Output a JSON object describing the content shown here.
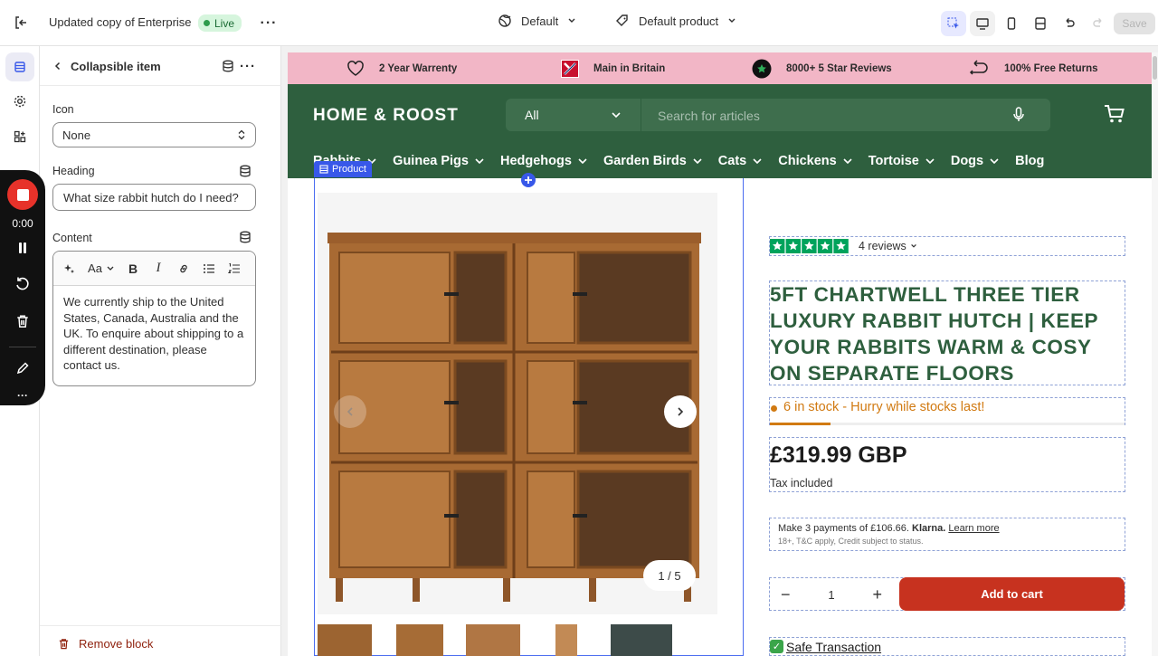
{
  "topbar": {
    "title": "Updated copy of Enterprise",
    "status": "Live",
    "theme_label": "Default",
    "template_label": "Default product",
    "save_label": "Save"
  },
  "recorder": {
    "time": "0:00"
  },
  "panel": {
    "title": "Collapsible item",
    "icon_label": "Icon",
    "icon_value": "None",
    "heading_label": "Heading",
    "heading_value": "What size rabbit hutch do I need?",
    "content_label": "Content",
    "content_text": "We currently ship to the United States, Canada, Australia and the UK. To enquire about shipping to a different destination, please contact us.",
    "remove_label": "Remove block"
  },
  "announcement": [
    {
      "icon": "heart-icon",
      "text": "2 Year Warrenty"
    },
    {
      "icon": "union-flag-icon",
      "text": "Main in Britain"
    },
    {
      "icon": "star-badge-icon",
      "text": "8000+ 5 Star Reviews"
    },
    {
      "icon": "return-arrow-icon",
      "text": "100% Free Returns"
    }
  ],
  "store": {
    "logo": "HOME & ROOST",
    "search_category": "All",
    "search_placeholder": "Search for articles",
    "nav": [
      "Rabbits",
      "Guinea Pigs",
      "Hedgehogs",
      "Garden Birds",
      "Cats",
      "Chickens",
      "Tortoise",
      "Dogs",
      "Blog"
    ]
  },
  "product": {
    "section_tag": "Product",
    "reviews": "4 reviews",
    "rating": 5,
    "title": "5FT CHARTWELL THREE TIER LUXURY RABBIT HUTCH | KEEP YOUR RABBITS WARM & COSY ON SEPARATE FLOORS",
    "stock": "6 in stock - Hurry while stocks last!",
    "stock_level": 0.17,
    "price": "£319.99 GBP",
    "tax": "Tax included",
    "klarna_pre": "Make 3 payments of £106.66.",
    "klarna_brand": "Klarna.",
    "klarna_link": "Learn more",
    "klarna_small": "18+, T&C apply, Credit subject to status.",
    "quantity": "1",
    "add_to_cart": "Add to cart",
    "safe": "Safe Transaction",
    "gallery_counter": "1 / 5"
  },
  "colors": {
    "brand_green": "#2e5f3e",
    "announce_pink": "#f2b6c6",
    "cart_red": "#c7321f",
    "stock_orange": "#d17a12",
    "selection_blue": "#3858e9"
  }
}
